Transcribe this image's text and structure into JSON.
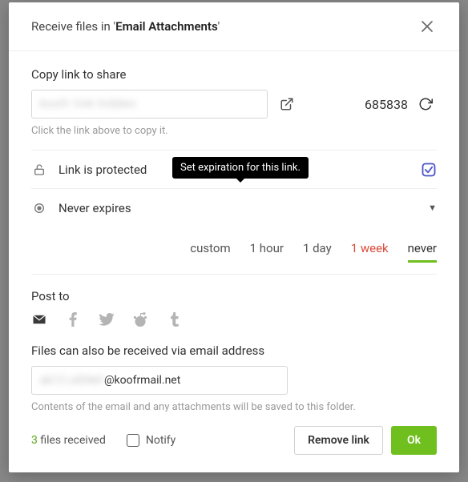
{
  "modal": {
    "title_prefix": "Receive files in '",
    "folder_name": "Email Attachments",
    "title_suffix": "'"
  },
  "link_section": {
    "label": "Copy link to share",
    "link_value": "koofr link hidden",
    "counter": "685838",
    "hint": "Click the link above to copy it."
  },
  "protect_row": {
    "label": "Link is protected",
    "tooltip": "Set expiration for this link.",
    "checked": true
  },
  "expire_row": {
    "label": "Never expires"
  },
  "expiry_options": {
    "custom": "custom",
    "hour": "1 hour",
    "day": "1 day",
    "week": "1 week",
    "never": "never"
  },
  "post_to": {
    "label": "Post to"
  },
  "email_section": {
    "label": "Files can also be received via email address",
    "obscured": "ab12 cd34ef",
    "domain": "@koofrmail.net",
    "hint": "Contents of the email and any attachments will be saved to this folder."
  },
  "footer": {
    "files_count": "3",
    "files_label": " files received",
    "notify_label": "Notify",
    "remove_label": "Remove link",
    "ok_label": "Ok"
  }
}
